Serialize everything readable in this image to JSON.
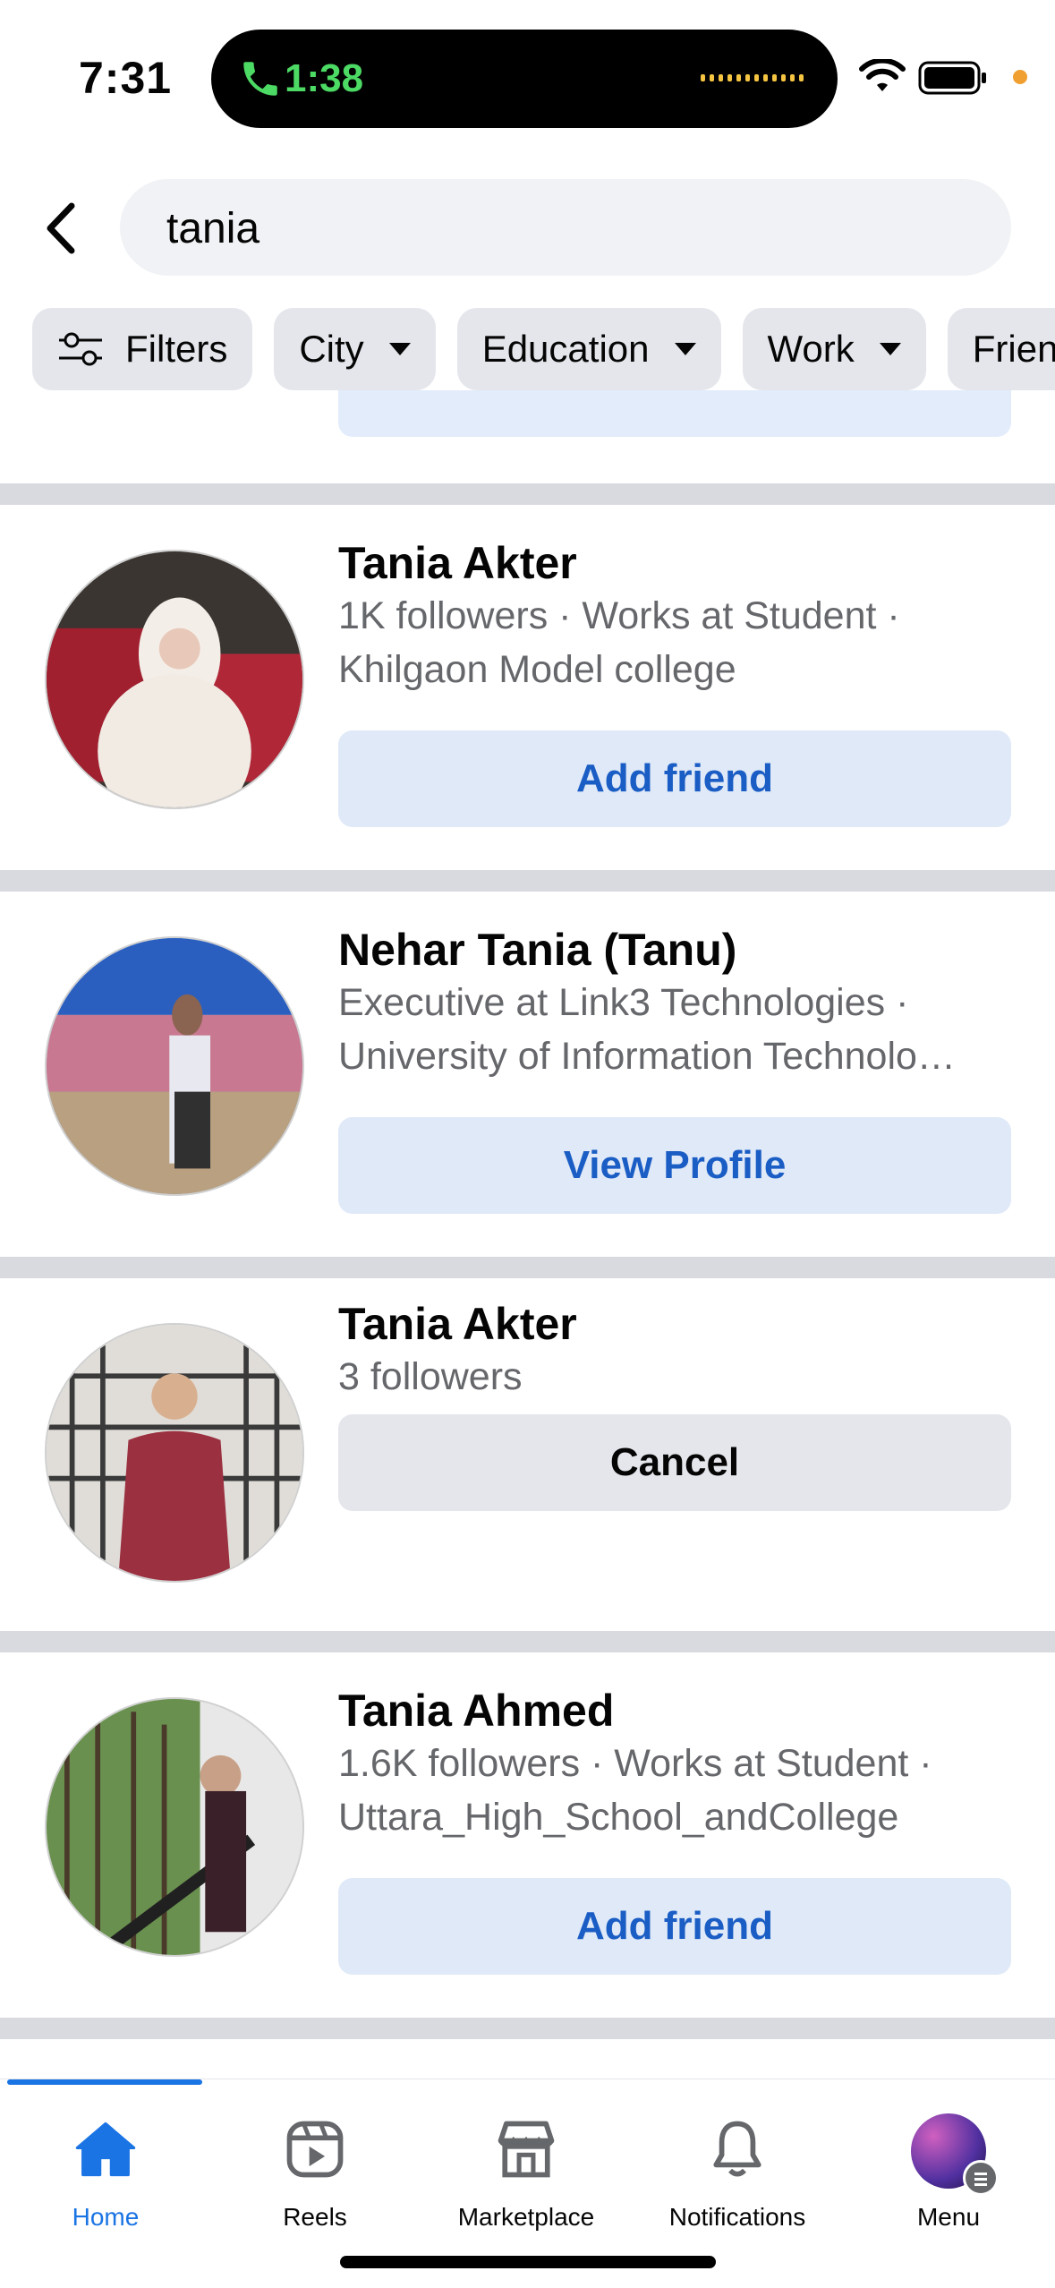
{
  "status_bar": {
    "time": "7:31",
    "call_time": "1:38"
  },
  "search": {
    "query": "tania"
  },
  "filters": [
    {
      "label": "Filters",
      "icon": "sliders-icon"
    },
    {
      "label": "City"
    },
    {
      "label": "Education"
    },
    {
      "label": "Work"
    },
    {
      "label": "Frien"
    }
  ],
  "results": [
    {
      "name": "Tania Akter",
      "line1": "1K followers · Works at Student ·",
      "line2": "Khilgaon Model college",
      "button": "Add friend",
      "button_style": "primary-light"
    },
    {
      "name": "Nehar Tania (Tanu)",
      "line1": "Executive at Link3 Technologies ·",
      "line2": "University of Information Technolo…",
      "button": "View Profile",
      "button_style": "primary-light"
    },
    {
      "name": "Tania Akter",
      "line1": "3 followers",
      "button": "Cancel",
      "button_style": "secondary"
    },
    {
      "name": "Tania Ahmed",
      "line1": "1.6K followers · Works at Student ·",
      "line2": "Uttara_High_School_andCollege",
      "button": "Add friend",
      "button_style": "primary-light"
    }
  ],
  "bottom_nav": {
    "active": "Home",
    "items": [
      {
        "label": "Home",
        "icon": "home-icon"
      },
      {
        "label": "Reels",
        "icon": "reels-icon"
      },
      {
        "label": "Marketplace",
        "icon": "marketplace-icon"
      },
      {
        "label": "Notifications",
        "icon": "bell-icon"
      },
      {
        "label": "Menu",
        "icon": "profile-avatar"
      }
    ]
  },
  "colors": {
    "accent": "#1b74e4",
    "button_blue_bg": "#dfe9f8",
    "button_blue_text": "#1a5dc4",
    "divider": "#d9dadf"
  }
}
